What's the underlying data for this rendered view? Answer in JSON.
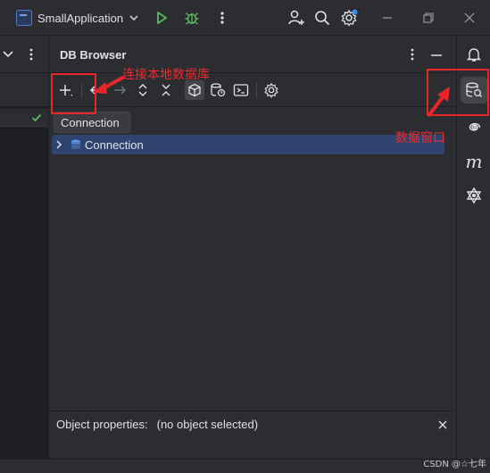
{
  "titlebar": {
    "project_name": "SmallApplication",
    "icons": [
      "project-icon",
      "chevron-down-icon",
      "run-icon",
      "debug-icon",
      "more-vert-icon",
      "add-user-icon",
      "search-icon",
      "settings-icon",
      "minimize-icon",
      "restore-icon",
      "close-icon"
    ]
  },
  "db_browser": {
    "title": "DB Browser",
    "toolbar_icons": [
      "add-connection-icon",
      "back-icon",
      "forward-icon",
      "expand-icon",
      "collapse-icon",
      "schema-icon",
      "db-clock-icon",
      "console-icon",
      "settings-icon"
    ],
    "tooltip": "Connection",
    "tree": [
      {
        "label": "Connection",
        "expanded": false,
        "selected": true
      }
    ],
    "properties_label": "Object properties:",
    "properties_value": "(no object selected)"
  },
  "rightbar": {
    "icons": [
      "notifications-icon",
      "database-icon",
      "spiral-icon",
      "m-icon",
      "ai-icon"
    ]
  },
  "annotations": {
    "connect_local_db": "连接本地数据库",
    "data_window": "数据窗口"
  },
  "watermark": "CSDN @☆七年",
  "colors": {
    "accent_red": "#e8262a",
    "selection": "#2e436e",
    "run_green": "#5fb865"
  }
}
